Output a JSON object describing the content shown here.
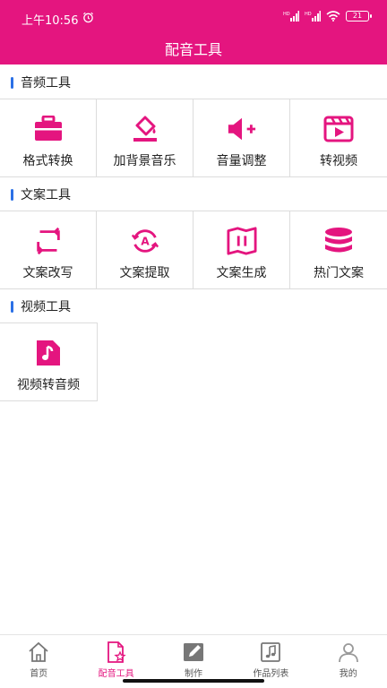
{
  "status_bar": {
    "time": "上午10:56",
    "signal1": "HD",
    "signal2": "HD",
    "battery": "21"
  },
  "header": {
    "title": "配音工具"
  },
  "colors": {
    "brand": "#e4157f",
    "section_marker": "#2b70e6"
  },
  "sections": [
    {
      "title": "音频工具",
      "items": [
        {
          "label": "格式转换",
          "icon": "toolbox-icon"
        },
        {
          "label": "加背景音乐",
          "icon": "paint-bucket-icon"
        },
        {
          "label": "音量调整",
          "icon": "volume-up-icon"
        },
        {
          "label": "转视频",
          "icon": "video-clip-icon"
        }
      ]
    },
    {
      "title": "文案工具",
      "items": [
        {
          "label": "文案改写",
          "icon": "swap-arrows-icon"
        },
        {
          "label": "文案提取",
          "icon": "text-recognize-icon"
        },
        {
          "label": "文案生成",
          "icon": "book-open-icon"
        },
        {
          "label": "热门文案",
          "icon": "database-icon"
        }
      ]
    },
    {
      "title": "视频工具",
      "items": [
        {
          "label": "视频转音频",
          "icon": "music-file-icon"
        }
      ]
    }
  ],
  "tabbar": [
    {
      "label": "首页",
      "icon": "home-icon",
      "active": false
    },
    {
      "label": "配音工具",
      "icon": "dubbing-tool-icon",
      "active": true
    },
    {
      "label": "制作",
      "icon": "edit-icon",
      "active": false
    },
    {
      "label": "作品列表",
      "icon": "music-list-icon",
      "active": false
    },
    {
      "label": "我的",
      "icon": "profile-icon",
      "active": false
    }
  ]
}
